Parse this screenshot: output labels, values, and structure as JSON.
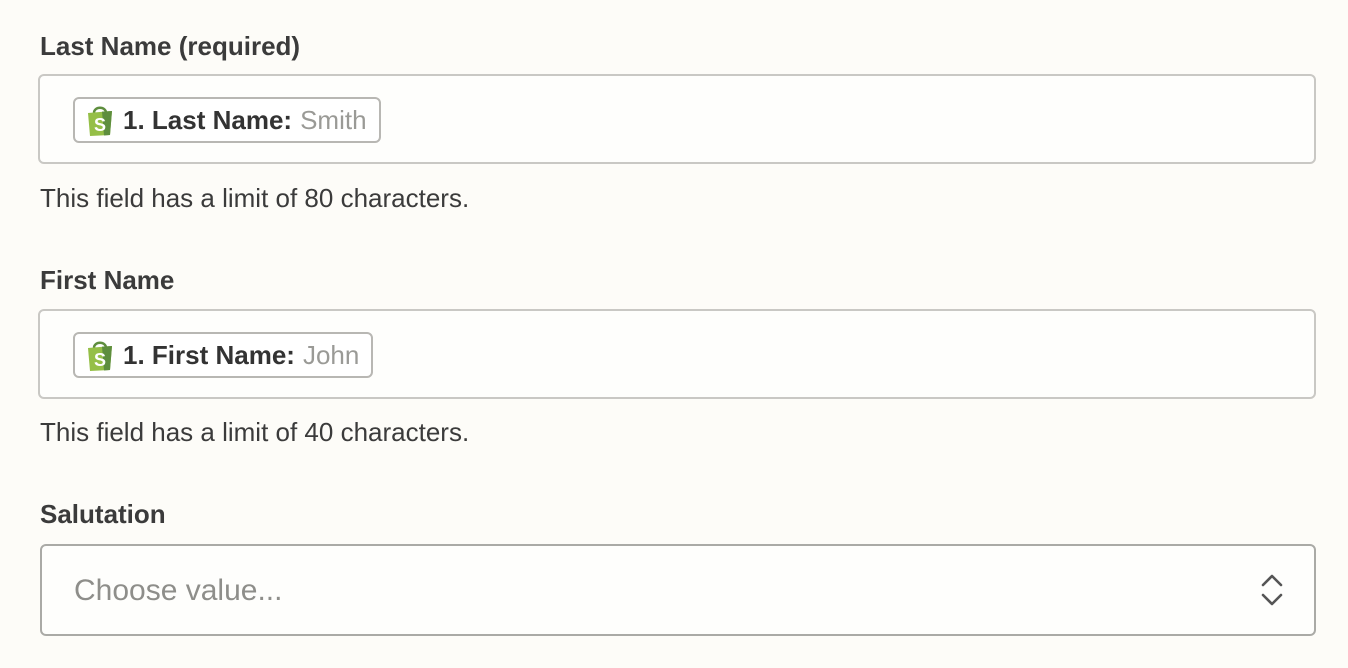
{
  "fields": {
    "last_name": {
      "label": "Last Name (required)",
      "token_key": "1. Last Name:",
      "token_value": "Smith",
      "help": "This field has a limit of 80 characters."
    },
    "first_name": {
      "label": "First Name",
      "token_key": "1. First Name:",
      "token_value": "John",
      "help": "This field has a limit of 40 characters."
    },
    "salutation": {
      "label": "Salutation",
      "placeholder": "Choose value..."
    }
  },
  "icons": {
    "token_app": "shopify-bag-icon",
    "select_toggle": "chevron-up-down-icon"
  },
  "colors": {
    "background": "#fdfcf8",
    "shopify_green": "#95bf47",
    "shopify_dark_green": "#5e8e3e"
  }
}
